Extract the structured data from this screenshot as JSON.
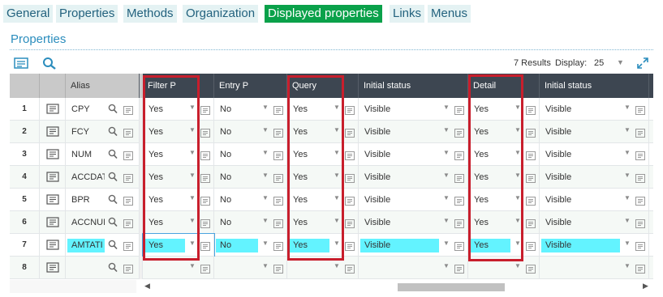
{
  "tabs": [
    {
      "label": "General"
    },
    {
      "label": "Properties"
    },
    {
      "label": "Methods"
    },
    {
      "label": "Organization"
    },
    {
      "label": "Displayed properties"
    },
    {
      "label": "Links"
    },
    {
      "label": "Menus"
    }
  ],
  "section": {
    "title": "Properties"
  },
  "toolbar": {
    "results": "7 Results",
    "display_label": "Display:",
    "display_value": "25"
  },
  "columns": [
    {
      "label": ""
    },
    {
      "label": ""
    },
    {
      "label": "Alias"
    },
    {
      "label": "Filter P"
    },
    {
      "label": "Entry P"
    },
    {
      "label": "Query"
    },
    {
      "label": "Initial status"
    },
    {
      "label": "Detail"
    },
    {
      "label": "Initial status"
    }
  ],
  "rows": [
    {
      "n": "1",
      "alias": "CPY",
      "filter": "Yes",
      "entry": "No",
      "query": "Yes",
      "status1": "Visible",
      "detail": "Yes",
      "status2": "Visible"
    },
    {
      "n": "2",
      "alias": "FCY",
      "filter": "Yes",
      "entry": "No",
      "query": "Yes",
      "status1": "Visible",
      "detail": "Yes",
      "status2": "Visible"
    },
    {
      "n": "3",
      "alias": "NUM",
      "filter": "Yes",
      "entry": "No",
      "query": "Yes",
      "status1": "Visible",
      "detail": "Yes",
      "status2": "Visible"
    },
    {
      "n": "4",
      "alias": "ACCDAT",
      "filter": "Yes",
      "entry": "No",
      "query": "Yes",
      "status1": "Visible",
      "detail": "Yes",
      "status2": "Visible"
    },
    {
      "n": "5",
      "alias": "BPR",
      "filter": "Yes",
      "entry": "No",
      "query": "Yes",
      "status1": "Visible",
      "detail": "Yes",
      "status2": "Visible"
    },
    {
      "n": "6",
      "alias": "ACCNUM",
      "filter": "Yes",
      "entry": "No",
      "query": "Yes",
      "status1": "Visible",
      "detail": "Yes",
      "status2": "Visible"
    },
    {
      "n": "7",
      "alias": "AMTATI",
      "filter": "Yes",
      "entry": "No",
      "query": "Yes",
      "status1": "Visible",
      "detail": "Yes",
      "status2": "Visible"
    },
    {
      "n": "8",
      "alias": "",
      "filter": "",
      "entry": "",
      "query": "",
      "status1": "",
      "detail": "",
      "status2": ""
    }
  ],
  "colors": {
    "active_tab": "#0aa14a",
    "header_dark": "#3d4651",
    "highlight": "#63f3ff",
    "annotation_red": "#c81e2c",
    "accent_blue": "#2b8dbd"
  },
  "icons": [
    "list-icon",
    "search-icon",
    "expand-icon",
    "row-detail-icon",
    "magnifier-icon",
    "dropdown-caret-icon"
  ]
}
